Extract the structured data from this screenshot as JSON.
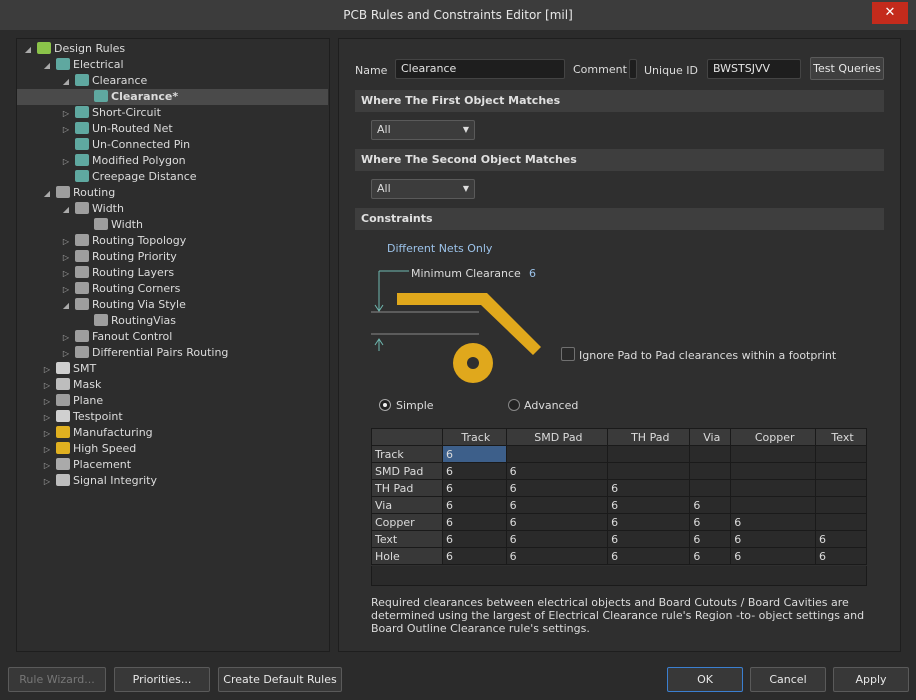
{
  "window": {
    "title": "PCB Rules and Constraints Editor [mil]",
    "close_glyph": "✕"
  },
  "tree": [
    {
      "label": "Design Rules",
      "arrow": "◢",
      "icon": "rules"
    },
    {
      "label": "Electrical",
      "arrow": "◢",
      "icon": "electrical"
    },
    {
      "label": "Clearance",
      "arrow": "◢",
      "icon": "electrical"
    },
    {
      "label": "Clearance*",
      "arrow": "",
      "icon": "electrical",
      "selected": true
    },
    {
      "label": "Short-Circuit",
      "arrow": "▷",
      "icon": "electrical"
    },
    {
      "label": "Un-Routed Net",
      "arrow": "▷",
      "icon": "electrical"
    },
    {
      "label": "Un-Connected Pin",
      "arrow": "",
      "icon": "electrical"
    },
    {
      "label": "Modified Polygon",
      "arrow": "▷",
      "icon": "electrical"
    },
    {
      "label": "Creepage Distance",
      "arrow": "",
      "icon": "electrical"
    },
    {
      "label": "Routing",
      "arrow": "◢",
      "icon": "routing"
    },
    {
      "label": "Width",
      "arrow": "◢",
      "icon": "routing"
    },
    {
      "label": "Width",
      "arrow": "",
      "icon": "routing"
    },
    {
      "label": "Routing Topology",
      "arrow": "▷",
      "icon": "routing"
    },
    {
      "label": "Routing Priority",
      "arrow": "▷",
      "icon": "routing"
    },
    {
      "label": "Routing Layers",
      "arrow": "▷",
      "icon": "routing"
    },
    {
      "label": "Routing Corners",
      "arrow": "▷",
      "icon": "routing"
    },
    {
      "label": "Routing Via Style",
      "arrow": "◢",
      "icon": "routing"
    },
    {
      "label": "RoutingVias",
      "arrow": "",
      "icon": "routing"
    },
    {
      "label": "Fanout Control",
      "arrow": "▷",
      "icon": "routing"
    },
    {
      "label": "Differential Pairs Routing",
      "arrow": "▷",
      "icon": "routing"
    },
    {
      "label": "SMT",
      "arrow": "▷",
      "icon": "smt"
    },
    {
      "label": "Mask",
      "arrow": "▷",
      "icon": "mask"
    },
    {
      "label": "Plane",
      "arrow": "▷",
      "icon": "plane"
    },
    {
      "label": "Testpoint",
      "arrow": "▷",
      "icon": "testpoint"
    },
    {
      "label": "Manufacturing",
      "arrow": "▷",
      "icon": "manufacturing"
    },
    {
      "label": "High Speed",
      "arrow": "▷",
      "icon": "highspeed"
    },
    {
      "label": "Placement",
      "arrow": "▷",
      "icon": "placement"
    },
    {
      "label": "Signal Integrity",
      "arrow": "▷",
      "icon": "signal"
    }
  ],
  "rule": {
    "name_label": "Name",
    "name": "Clearance",
    "comment_label": "Comment",
    "comment": "",
    "uid_label": "Unique ID",
    "uid": "BWSTSJVV",
    "test_queries": "Test Queries"
  },
  "first_match": {
    "title": "Where The First Object Matches",
    "value": "All"
  },
  "second_match": {
    "title": "Where The Second Object Matches",
    "value": "All"
  },
  "constraints": {
    "title": "Constraints",
    "net_scope": "Different Nets Only",
    "min_clearance_label": "Minimum Clearance",
    "min_clearance_value": "6",
    "ignore_pad_label": "Ignore Pad to Pad clearances within a footprint",
    "mode_simple": "Simple",
    "mode_advanced": "Advanced",
    "track_color": "#e0a81c"
  },
  "matrix": {
    "columns": [
      "Track",
      "SMD Pad",
      "TH Pad",
      "Via",
      "Copper",
      "Text"
    ],
    "rows": [
      {
        "label": "Track",
        "values": [
          "6",
          "",
          "",
          "",
          "",
          ""
        ]
      },
      {
        "label": "SMD Pad",
        "values": [
          "6",
          "6",
          "",
          "",
          "",
          ""
        ]
      },
      {
        "label": "TH Pad",
        "values": [
          "6",
          "6",
          "6",
          "",
          "",
          ""
        ]
      },
      {
        "label": "Via",
        "values": [
          "6",
          "6",
          "6",
          "6",
          "",
          ""
        ]
      },
      {
        "label": "Copper",
        "values": [
          "6",
          "6",
          "6",
          "6",
          "6",
          ""
        ]
      },
      {
        "label": "Text",
        "values": [
          "6",
          "6",
          "6",
          "6",
          "6",
          "6"
        ]
      },
      {
        "label": "Hole",
        "values": [
          "6",
          "6",
          "6",
          "6",
          "6",
          "6"
        ]
      }
    ]
  },
  "note": "Required clearances between electrical objects and Board Cutouts / Board Cavities are determined using the largest of Electrical Clearance rule's Region -to- object settings and Board Outline Clearance rule's settings.",
  "footer": {
    "rule_wizard": "Rule Wizard...",
    "priorities": "Priorities...",
    "create_default": "Create Default Rules",
    "ok": "OK",
    "cancel": "Cancel",
    "apply": "Apply"
  }
}
